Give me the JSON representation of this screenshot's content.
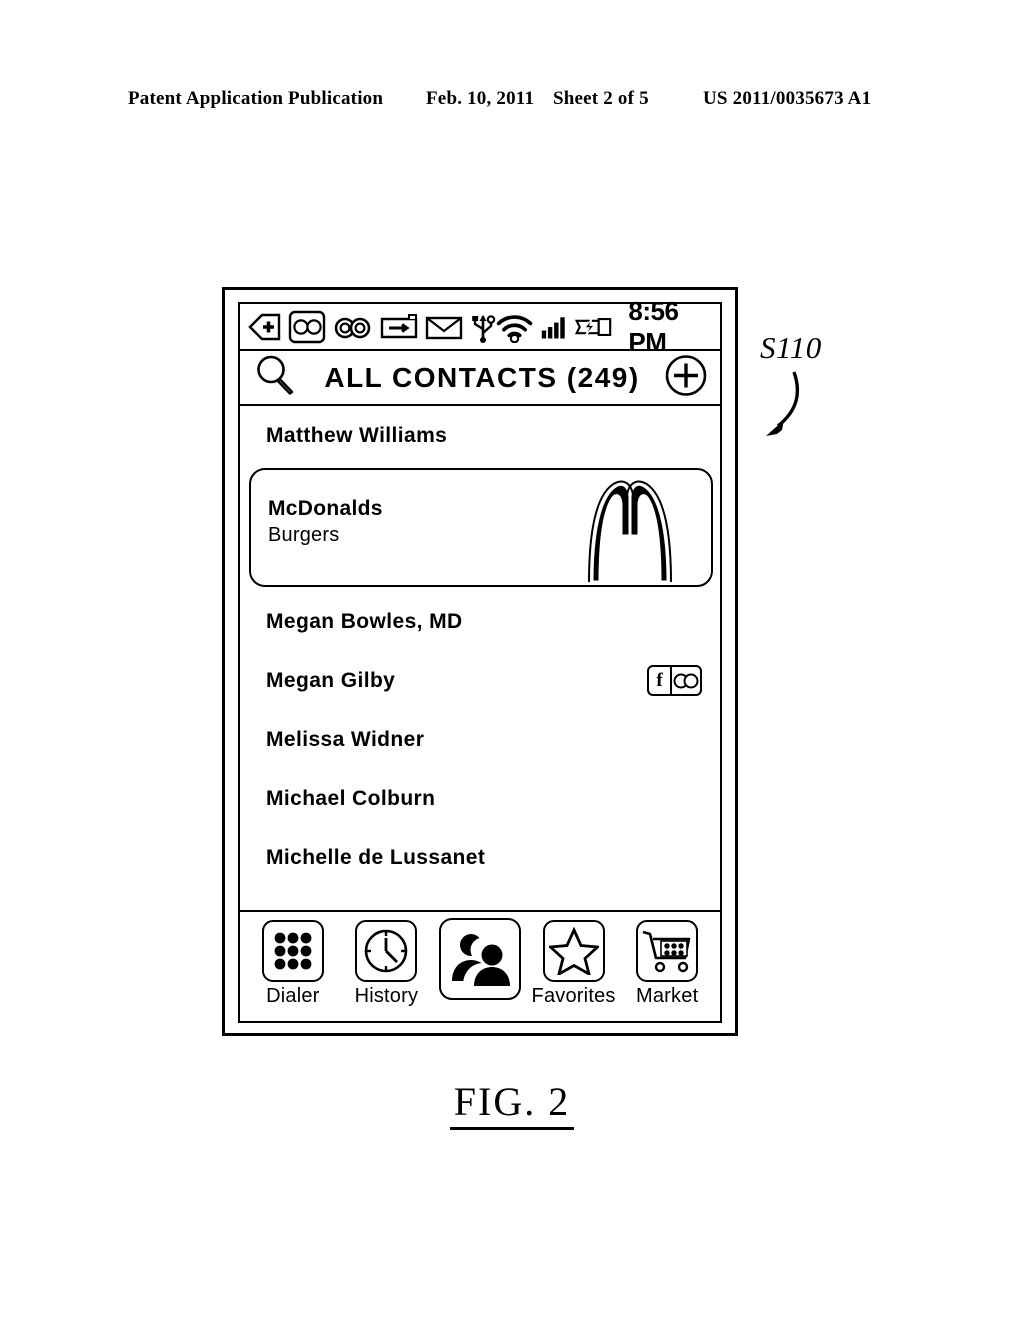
{
  "publication_header": {
    "left": "Patent Application Publication",
    "date": "Feb. 10, 2011",
    "sheet": "Sheet 2 of 5",
    "number": "US 2011/0035673 A1"
  },
  "figure": {
    "caption": "FIG.  2",
    "callout_label": "S110"
  },
  "device": {
    "status_bar": {
      "time": "8:56 PM",
      "icons_left": [
        "back-plus-icon",
        "two-circles-box-icon",
        "voicemail-icon",
        "sms-card-icon",
        "email-envelope-icon",
        "usb-icon"
      ],
      "icons_right": [
        "wifi-icon",
        "signal-bars-icon",
        "battery-charging-icon"
      ]
    },
    "title_bar": {
      "search_icon": "search-icon",
      "title": "ALL  CONTACTS  (249)",
      "add_icon": "add-contact-icon"
    },
    "contacts": [
      {
        "name": "Matthew  Williams",
        "badges": []
      },
      {
        "name": "Megan Bowles, MD",
        "badges": []
      },
      {
        "name": "Megan  Gilby",
        "badges": [
          "facebook-badge",
          "social-circles-badge"
        ]
      },
      {
        "name": "Melissa  Widner",
        "badges": []
      },
      {
        "name": "Michael  Colburn",
        "badges": []
      },
      {
        "name": "Michelle  de  Lussanet",
        "badges": []
      }
    ],
    "expanded_card": {
      "title": "McDonalds",
      "subtitle": "Burgers",
      "logo": "mcdonalds-arches-logo"
    },
    "social_badge": {
      "facebook_glyph": "f",
      "circles_glyph": "social-circles-icon"
    },
    "tabs": [
      {
        "label": "Dialer",
        "icon": "dialer-keypad-icon",
        "active": false
      },
      {
        "label": "History",
        "icon": "clock-icon",
        "active": false
      },
      {
        "label": "",
        "icon": "contacts-people-icon",
        "active": true
      },
      {
        "label": "Favorites",
        "icon": "star-icon",
        "active": false
      },
      {
        "label": "Market",
        "icon": "shopping-cart-icon",
        "active": false
      }
    ]
  }
}
